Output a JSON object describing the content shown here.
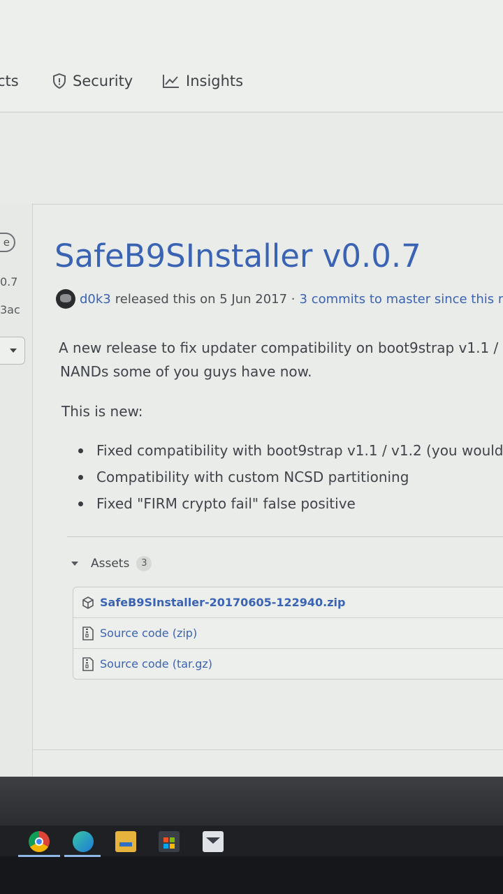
{
  "nav": {
    "partial_tab": "cts",
    "security": "Security",
    "insights": "Insights"
  },
  "sidebar": {
    "chip": "e",
    "tag": "0.7",
    "commit": "3ac"
  },
  "release": {
    "title": "SafeB9SInstaller v0.0.7",
    "author": "d0k3",
    "released_text": "released this on 5 Jun 2017 ·",
    "commits_link": "3 commits to master since this re",
    "desc_line1": "A new release to fix updater compatibility on boot9strap v1.1 /",
    "desc_line2": "NANDs some of you guys have now.",
    "new_heading": "This is new:",
    "bullets": [
      "Fixed compatibility with boot9strap v1.1 / v1.2 (you wouldn",
      "Compatibility with custom NCSD partitioning",
      "Fixed \"FIRM crypto fail\" false positive"
    ]
  },
  "assets": {
    "label": "Assets",
    "count": "3",
    "items": [
      {
        "label": "SafeB9SInstaller-20170605-122940.zip",
        "icon": "package-icon"
      },
      {
        "label": "Source code (zip)",
        "icon": "file-zip-icon"
      },
      {
        "label": "Source code (tar.gz)",
        "icon": "file-zip-icon"
      }
    ]
  },
  "taskbar": {
    "apps": [
      "chrome-icon",
      "edge-icon",
      "file-explorer-icon",
      "store-icon",
      "mail-icon"
    ]
  },
  "colors": {
    "link": "#3a63b4",
    "text": "#40444a",
    "taskbar": "#1e2024"
  }
}
